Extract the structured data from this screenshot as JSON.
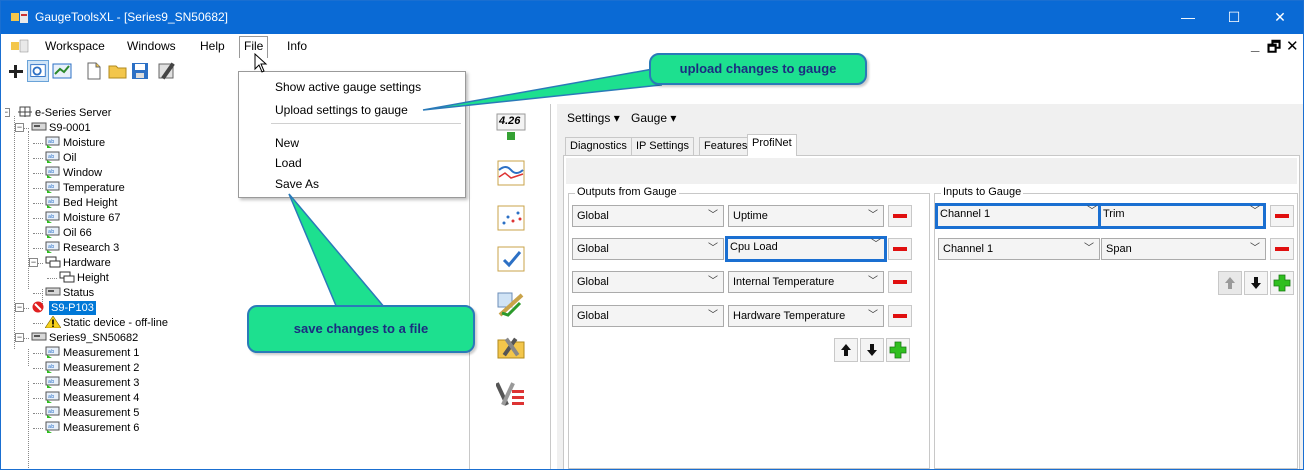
{
  "window": {
    "title": "GaugeToolsXL - [Series9_SN50682]",
    "minimize_glyph": "—",
    "maximize_glyph": "☐",
    "close_glyph": "✕"
  },
  "menubar": {
    "items": [
      {
        "label": "Workspace"
      },
      {
        "label": "Windows"
      },
      {
        "label": "Help"
      },
      {
        "label": "File"
      },
      {
        "label": "Info"
      }
    ],
    "mdi_minimize": "_",
    "mdi_restore": "🗗",
    "mdi_close": "✕"
  },
  "file_menu": {
    "items": [
      {
        "label": "Show active gauge settings"
      },
      {
        "label": "Upload settings to gauge"
      },
      {
        "label": "New"
      },
      {
        "label": "Load"
      },
      {
        "label": "Save As"
      }
    ]
  },
  "tree": {
    "items": [
      {
        "label": "e-Series Server",
        "icon": "server-icon"
      },
      {
        "label": "S9-0001",
        "icon": "device-icon"
      },
      {
        "label": "Moisture",
        "icon": "measurement-icon"
      },
      {
        "label": "Oil",
        "icon": "measurement-icon"
      },
      {
        "label": "Window",
        "icon": "measurement-icon"
      },
      {
        "label": "Temperature",
        "icon": "measurement-icon"
      },
      {
        "label": "Bed Height",
        "icon": "measurement-icon"
      },
      {
        "label": "Moisture 67",
        "icon": "measurement-icon"
      },
      {
        "label": "Oil 66",
        "icon": "measurement-icon"
      },
      {
        "label": "Research 3",
        "icon": "measurement-icon"
      },
      {
        "label": "Hardware",
        "icon": "hardware-icon"
      },
      {
        "label": "Height",
        "icon": "hardware-icon"
      },
      {
        "label": "Status",
        "icon": "device-icon"
      },
      {
        "label": "S9-P103",
        "icon": "error-icon"
      },
      {
        "label": "Static device - off-line",
        "icon": "warning-icon"
      },
      {
        "label": "Series9_SN50682",
        "icon": "device-icon"
      },
      {
        "label": "Measurement 1",
        "icon": "measurement-icon"
      },
      {
        "label": "Measurement 2",
        "icon": "measurement-icon"
      },
      {
        "label": "Measurement 3",
        "icon": "measurement-icon"
      },
      {
        "label": "Measurement 4",
        "icon": "measurement-icon"
      },
      {
        "label": "Measurement 5",
        "icon": "measurement-icon"
      },
      {
        "label": "Measurement 6",
        "icon": "measurement-icon"
      }
    ]
  },
  "strip": {
    "version_label": "4.26"
  },
  "content": {
    "settings_menu": "Settings ▾",
    "gauge_menu": "Gauge ▾",
    "tabs": [
      {
        "label": "Diagnostics"
      },
      {
        "label": "IP Settings"
      },
      {
        "label": "Features"
      },
      {
        "label": "ProfiNet"
      }
    ],
    "outputs": {
      "title": "Outputs from Gauge",
      "rows": [
        {
          "source": "Global",
          "value": "Uptime"
        },
        {
          "source": "Global",
          "value": "Cpu Load"
        },
        {
          "source": "Global",
          "value": "Internal Temperature"
        },
        {
          "source": "Global",
          "value": "Hardware Temperature"
        }
      ]
    },
    "inputs": {
      "title": "Inputs to Gauge",
      "rows": [
        {
          "source": "Channel 1",
          "value": "Trim"
        },
        {
          "source": "Channel 1",
          "value": "Span"
        }
      ]
    }
  },
  "callouts": {
    "upload": "upload changes to gauge",
    "save": "save changes to a file"
  },
  "colors": {
    "titlebar": "#0a6ad5",
    "callout_fill": "#1de08f",
    "callout_text": "#1b2d80",
    "highlight_border": "#1a6fd1",
    "remove_red": "#e00f0f",
    "add_green": "#2fbf1f"
  }
}
